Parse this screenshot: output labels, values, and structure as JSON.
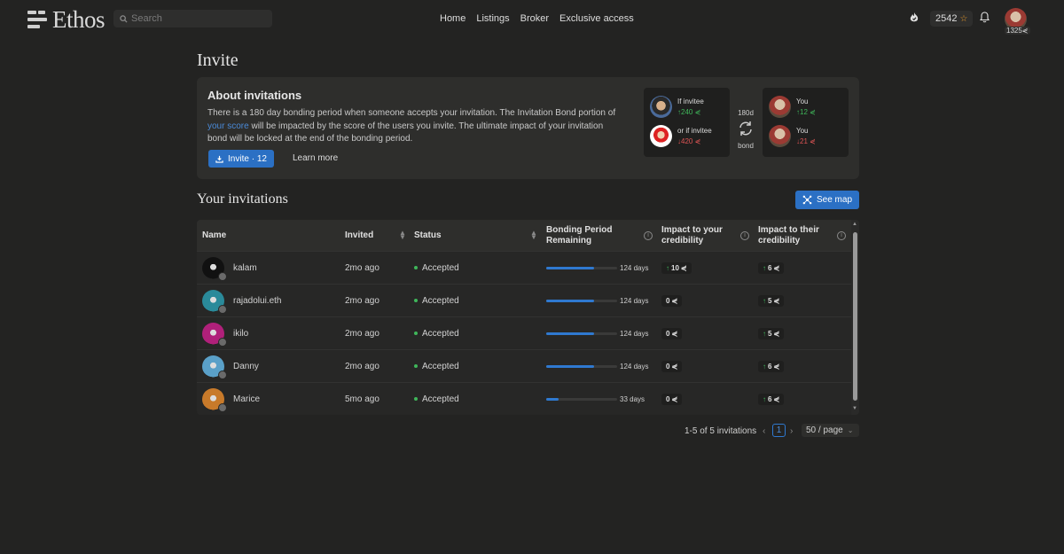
{
  "brand": {
    "name": "Ethos"
  },
  "search": {
    "placeholder": "Search"
  },
  "nav": {
    "links": [
      "Home",
      "Listings",
      "Broker",
      "Exclusive access"
    ]
  },
  "user": {
    "points": "2542",
    "score": "1325"
  },
  "page": {
    "title": "Invite"
  },
  "about": {
    "title": "About invitations",
    "text_before": "There is a 180 day bonding period when someone accepts your invitation. The Invitation Bond portion of ",
    "link_text": "your score",
    "text_after": " will be impacted by the score of the users you invite. The ultimate impact of your invitation bond will be locked at the end of the bonding period.",
    "invite_button": "Invite · 12",
    "learn_more": "Learn more",
    "diagram": {
      "invitee_good_label": "If invitee",
      "invitee_good_value": "240",
      "invitee_bad_label": "or if invitee",
      "invitee_bad_value": "420",
      "bond_days": "180d",
      "bond_label": "bond",
      "you_label_1": "You",
      "you_value_1": "12",
      "you_label_2": "You",
      "you_value_2": "21"
    }
  },
  "invitations": {
    "title": "Your invitations",
    "see_map": "See map",
    "columns": {
      "name": "Name",
      "invited": "Invited",
      "status": "Status",
      "bonding": "Bonding Period Remaining",
      "impact_yours": "Impact to your credibility",
      "impact_theirs": "Impact to their credibility"
    },
    "rows": [
      {
        "name": "kalam",
        "invited": "2mo ago",
        "status": "Accepted",
        "progress": 0.67,
        "days": "124 days",
        "impact_yours": "10",
        "impact_yours_up": true,
        "impact_theirs": "6",
        "avatar_color": "#111111"
      },
      {
        "name": "rajadolui.eth",
        "invited": "2mo ago",
        "status": "Accepted",
        "progress": 0.67,
        "days": "124 days",
        "impact_yours": "0",
        "impact_yours_up": false,
        "impact_theirs": "5",
        "avatar_color": "#2a8a9a"
      },
      {
        "name": "ikilo",
        "invited": "2mo ago",
        "status": "Accepted",
        "progress": 0.67,
        "days": "124 days",
        "impact_yours": "0",
        "impact_yours_up": false,
        "impact_theirs": "5",
        "avatar_color": "#b0207a"
      },
      {
        "name": "Danny",
        "invited": "2mo ago",
        "status": "Accepted",
        "progress": 0.67,
        "days": "124 days",
        "impact_yours": "0",
        "impact_yours_up": false,
        "impact_theirs": "6",
        "avatar_color": "#5aa0c8"
      },
      {
        "name": "Marice",
        "invited": "5mo ago",
        "status": "Accepted",
        "progress": 0.18,
        "days": "33 days",
        "impact_yours": "0",
        "impact_yours_up": false,
        "impact_theirs": "6",
        "avatar_color": "#c87a2a"
      }
    ]
  },
  "pagination": {
    "summary": "1-5 of 5 invitations",
    "current": "1",
    "page_size": "50 / page"
  },
  "colors": {
    "accent": "#2b70c4",
    "positive": "#3fb75a",
    "negative": "#e05555"
  }
}
